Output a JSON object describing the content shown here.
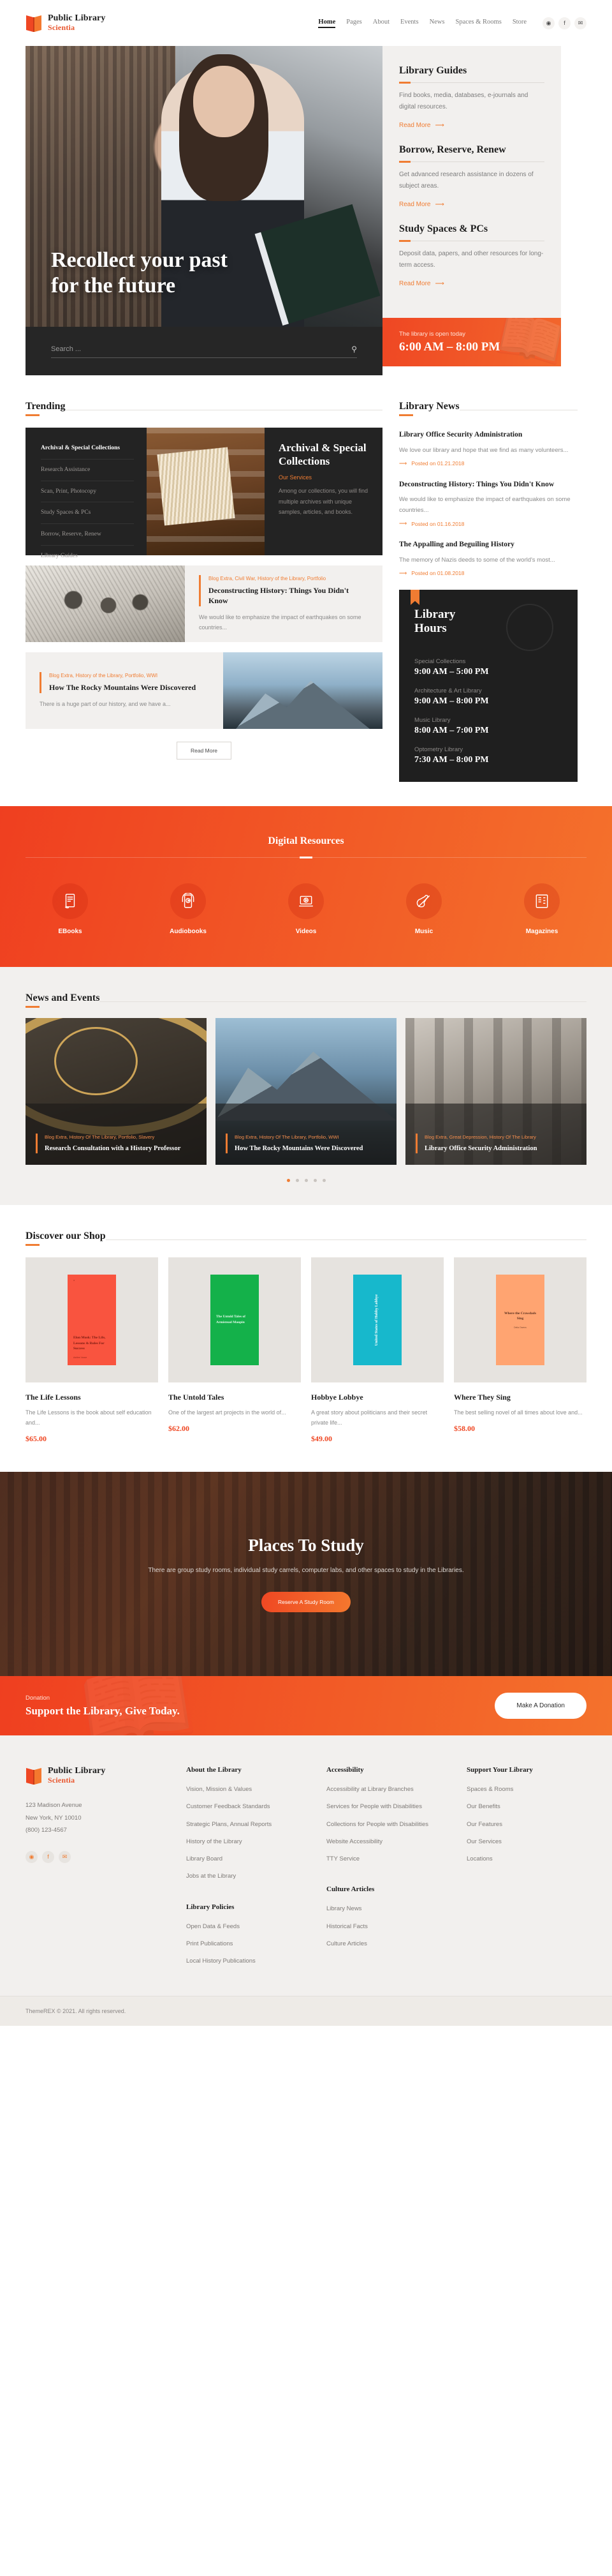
{
  "brand": {
    "title": "Public Library",
    "subtitle": "Scientia",
    "icon": "open-book-icon"
  },
  "nav": {
    "items": [
      {
        "label": "Home",
        "active": true
      },
      {
        "label": "Pages",
        "active": false
      },
      {
        "label": "About",
        "active": false
      },
      {
        "label": "Events",
        "active": false
      },
      {
        "label": "News",
        "active": false
      },
      {
        "label": "Spaces & Rooms",
        "active": false
      },
      {
        "label": "Store",
        "active": false
      }
    ],
    "social": [
      {
        "name": "dribbble-icon",
        "glyph": "◉"
      },
      {
        "name": "facebook-icon",
        "glyph": "f"
      },
      {
        "name": "twitter-icon",
        "glyph": "✉"
      }
    ]
  },
  "hero": {
    "title_line1": "Recollect your past",
    "title_line2": "for the future",
    "search_placeholder": "Search ...",
    "search_value": "",
    "search_icon": "search-icon",
    "hours_strip": {
      "label": "The library is open today",
      "time": "6:00 AM – 8:00 PM"
    },
    "guides": [
      {
        "title": "Library Guides",
        "desc": "Find books, media, databases, e-journals and digital resources.",
        "link": "Read More"
      },
      {
        "title": "Borrow, Reserve, Renew",
        "desc": "Get advanced research assistance in dozens of subject areas.",
        "link": "Read More"
      },
      {
        "title": "Study Spaces & PCs",
        "desc": "Deposit data, papers, and other resources for long-term access.",
        "link": "Read More"
      }
    ]
  },
  "trending": {
    "heading": "Trending",
    "feature": {
      "list": [
        "Archival & Special Collections",
        "Research Assistance",
        "Scan, Print, Photocopy",
        "Study Spaces & PCs",
        "Borrow, Reserve, Renew",
        "Library Guides"
      ],
      "title": "Archival & Special Collections",
      "tag": "Our Services",
      "desc": "Among our collections, you will find multiple archives with unique samples, articles, and books."
    },
    "posts": [
      {
        "cats": "Blog Extra, Civil War, History of the Library, Portfolio",
        "title": "Deconstructing History: Things You Didn't Know",
        "excerpt": "We would like to emphasize the impact of earthquakes on some countries...",
        "image_side": "left",
        "image_kind": "engraving"
      },
      {
        "cats": "Blog Extra, History of the Library, Portfolio, WWI",
        "title": "How The Rocky Mountains Were Discovered",
        "excerpt": "There is a huge part of our history, and we have a...",
        "image_side": "right",
        "image_kind": "mountain"
      }
    ],
    "read_more_button": "Read More"
  },
  "library_news": {
    "heading": "Library News",
    "items": [
      {
        "title": "Library Office Security Administration",
        "excerpt": "We love our library and hope that we find as many volunteers...",
        "date": "Posted on 01.21.2018"
      },
      {
        "title": "Deconstructing History: Things You Didn't Know",
        "excerpt": "We would like to emphasize the impact of earthquakes on some countries...",
        "date": "Posted on 01.16.2018"
      },
      {
        "title": "The Appalling and Beguiling History",
        "excerpt": "The memory of Nazis deeds to some of the world's most...",
        "date": "Posted on 01.08.2018"
      }
    ],
    "hours_card": {
      "title_line1": "Library",
      "title_line2": "Hours",
      "rows": [
        {
          "label": "Special Collections",
          "time": "9:00 AM – 5:00 PM"
        },
        {
          "label": "Architecture & Art Library",
          "time": "9:00 AM – 8:00 PM"
        },
        {
          "label": "Music Library",
          "time": "8:00 AM – 7:00 PM"
        },
        {
          "label": "Optometry Library",
          "time": "7:30 AM – 8:00 PM"
        }
      ]
    }
  },
  "digital_resources": {
    "heading": "Digital Resources",
    "items": [
      {
        "label": "EBooks",
        "icon": "ebook-reader-icon"
      },
      {
        "label": "Audiobooks",
        "icon": "headphones-phone-icon"
      },
      {
        "label": "Videos",
        "icon": "laptop-play-icon"
      },
      {
        "label": "Music",
        "icon": "violin-icon"
      },
      {
        "label": "Magazines",
        "icon": "magazine-icon"
      }
    ]
  },
  "events": {
    "heading": "News and Events",
    "cards": [
      {
        "cats": "Blog Extra, History Of The Library, Portfolio, Slavery",
        "title": "Research Consultation with a History Professor"
      },
      {
        "cats": "Blog Extra, History Of The Library, Portfolio, WWI",
        "title": "How The Rocky Mountains Were Discovered"
      },
      {
        "cats": "Blog Extra, Great Depression, History Of The Library",
        "title": "Library Office Security Administration"
      }
    ],
    "dots": 5,
    "active_dot": 0
  },
  "shop": {
    "heading": "Discover our Shop",
    "products": [
      {
        "name": "The Life Lessons",
        "desc": "The Life Lessons is the book about self education and...",
        "price": "$65.00",
        "cover_color": "#f9543f",
        "cover_text_color": "#7a1c12",
        "cover_title": "Elon Musk: The Life, Lessons & Rules For Success",
        "cover_author": "Ashlee Vance",
        "cover_layout": "bottom"
      },
      {
        "name": "The Untold Tales",
        "desc": "One of the largest art projects in the world of...",
        "price": "$62.00",
        "cover_color": "#14b14a",
        "cover_text_color": "#eafbef",
        "cover_title": "The Untold Tales of Armistead Maupin",
        "cover_author": "Armistead Maupin",
        "cover_layout": "mid"
      },
      {
        "name": "Hobbye Lobbye",
        "desc": "A great story about politicians and their secret private life...",
        "price": "$49.00",
        "cover_color": "#17b8cc",
        "cover_text_color": "#ffffff",
        "cover_title": "United States of Hobby Lobbye",
        "cover_author": "Hobby Lobbye",
        "cover_layout": "vert"
      },
      {
        "name": "Where They Sing",
        "desc": "The best selling novel of all times about love and...",
        "price": "$58.00",
        "cover_color": "#ffa471",
        "cover_text_color": "#5b3120",
        "cover_title": "Where the Crawdads Sing",
        "cover_author": "Delia Owens",
        "cover_layout": "ctr"
      }
    ]
  },
  "places": {
    "title": "Places To Study",
    "desc": "There are group study rooms, individual study carrels, computer labs, and other spaces to study in the Libraries.",
    "button": "Reserve A Study Room"
  },
  "donation": {
    "label": "Donation",
    "headline": "Support the Library, Give Today.",
    "button": "Make A Donation"
  },
  "footer": {
    "brand": {
      "title": "Public Library",
      "subtitle": "Scientia"
    },
    "address_line1": "123 Madison Avenue",
    "address_line2": "New York, NY 10010",
    "phone": "(800) 123-4567",
    "social": [
      {
        "name": "dribbble-icon",
        "glyph": "◉"
      },
      {
        "name": "facebook-icon",
        "glyph": "f"
      },
      {
        "name": "twitter-icon",
        "glyph": "✉"
      }
    ],
    "columns": [
      {
        "heading": "About the Library",
        "links": [
          "Vision, Mission & Values",
          "Customer Feedback Standards",
          "Strategic Plans, Annual Reports",
          "History of the Library",
          "Library Board",
          "Jobs at the Library"
        ],
        "heading2": "Library Policies",
        "links2": [
          "Open Data & Feeds",
          "Print Publications",
          "Local History Publications"
        ]
      },
      {
        "heading": "Accessibility",
        "links": [
          "Accessibility at Library Branches",
          "Services for People with Disabilities",
          "Collections for People with Disabilities",
          "Website Accessibility",
          "TTY Service"
        ],
        "heading2": "Culture Articles",
        "links2": [
          "Library News",
          "Historical Facts",
          "Culture Articles"
        ]
      },
      {
        "heading": "Support Your Library",
        "links": [
          "Spaces & Rooms",
          "Our Benefits",
          "Our Features",
          "Our Services",
          "Locations"
        ],
        "heading2": "",
        "links2": []
      }
    ],
    "copyright": "ThemeREX © 2021. All rights reserved."
  },
  "colors": {
    "accent": "#f07c32",
    "accent_red": "#ef4723",
    "dark": "#232323",
    "light_bg": "#f2f0ee"
  }
}
